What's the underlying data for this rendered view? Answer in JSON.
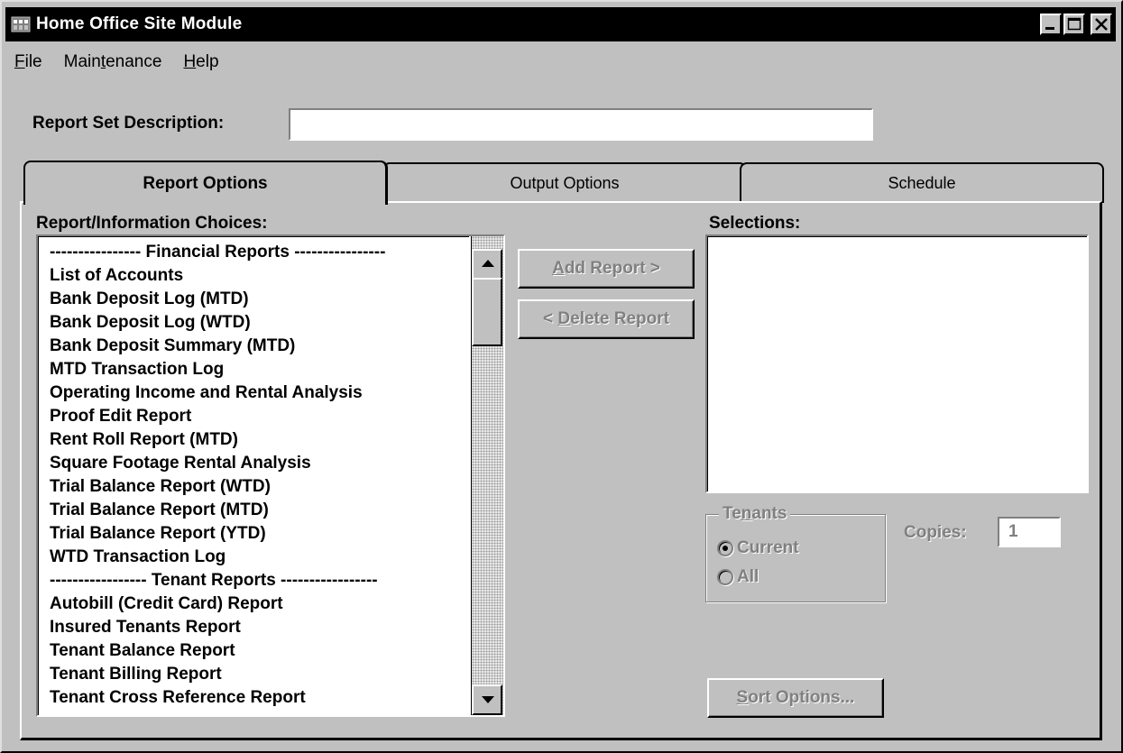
{
  "window": {
    "title": "Home Office Site Module",
    "controls": [
      "minimize",
      "maximize",
      "close"
    ]
  },
  "menu": {
    "items": [
      {
        "label": "File",
        "mnemonic": "F"
      },
      {
        "label": "Maintenance",
        "mnemonic": "t"
      },
      {
        "label": "Help",
        "mnemonic": "H"
      }
    ]
  },
  "report_set": {
    "label": "Report Set Description:",
    "value": ""
  },
  "tabs": [
    {
      "label": "Report Options",
      "active": true
    },
    {
      "label": "Output Options",
      "active": false
    },
    {
      "label": "Schedule",
      "active": false
    }
  ],
  "choices": {
    "label": "Report/Information Choices:",
    "items": [
      "---------------- Financial Reports ----------------",
      "List of Accounts",
      "Bank Deposit Log (MTD)",
      "Bank Deposit Log (WTD)",
      "Bank Deposit Summary (MTD)",
      "MTD Transaction Log",
      "Operating Income and Rental Analysis",
      "Proof Edit Report",
      "Rent Roll Report (MTD)",
      "Square Footage Rental Analysis",
      "Trial Balance Report (WTD)",
      "Trial Balance Report (MTD)",
      "Trial Balance Report (YTD)",
      "WTD Transaction Log",
      "----------------- Tenant Reports -----------------",
      "Autobill (Credit Card) Report",
      "Insured Tenants Report",
      "Tenant Balance Report",
      "Tenant Billing Report",
      "Tenant Cross Reference Report"
    ]
  },
  "buttons": {
    "add_report": {
      "mnemonic": "A",
      "rest": "dd Report >"
    },
    "delete_report": {
      "prefix": "< ",
      "mnemonic": "D",
      "rest": "elete Report"
    },
    "sort_options": {
      "mnemonic": "S",
      "rest": "ort Options..."
    }
  },
  "selections": {
    "label": "Selections:",
    "items": []
  },
  "tenants": {
    "legend_prefix": "Te",
    "legend_mnemonic": "n",
    "legend_suffix": "ants",
    "options": [
      {
        "label": "Current",
        "checked": true
      },
      {
        "label": "All",
        "checked": false
      }
    ]
  },
  "copies": {
    "label": "Copies:",
    "value": "1"
  },
  "colors": {
    "face": "#c0c0c0",
    "titlebar": "#000000",
    "disabled_text": "#808080"
  }
}
